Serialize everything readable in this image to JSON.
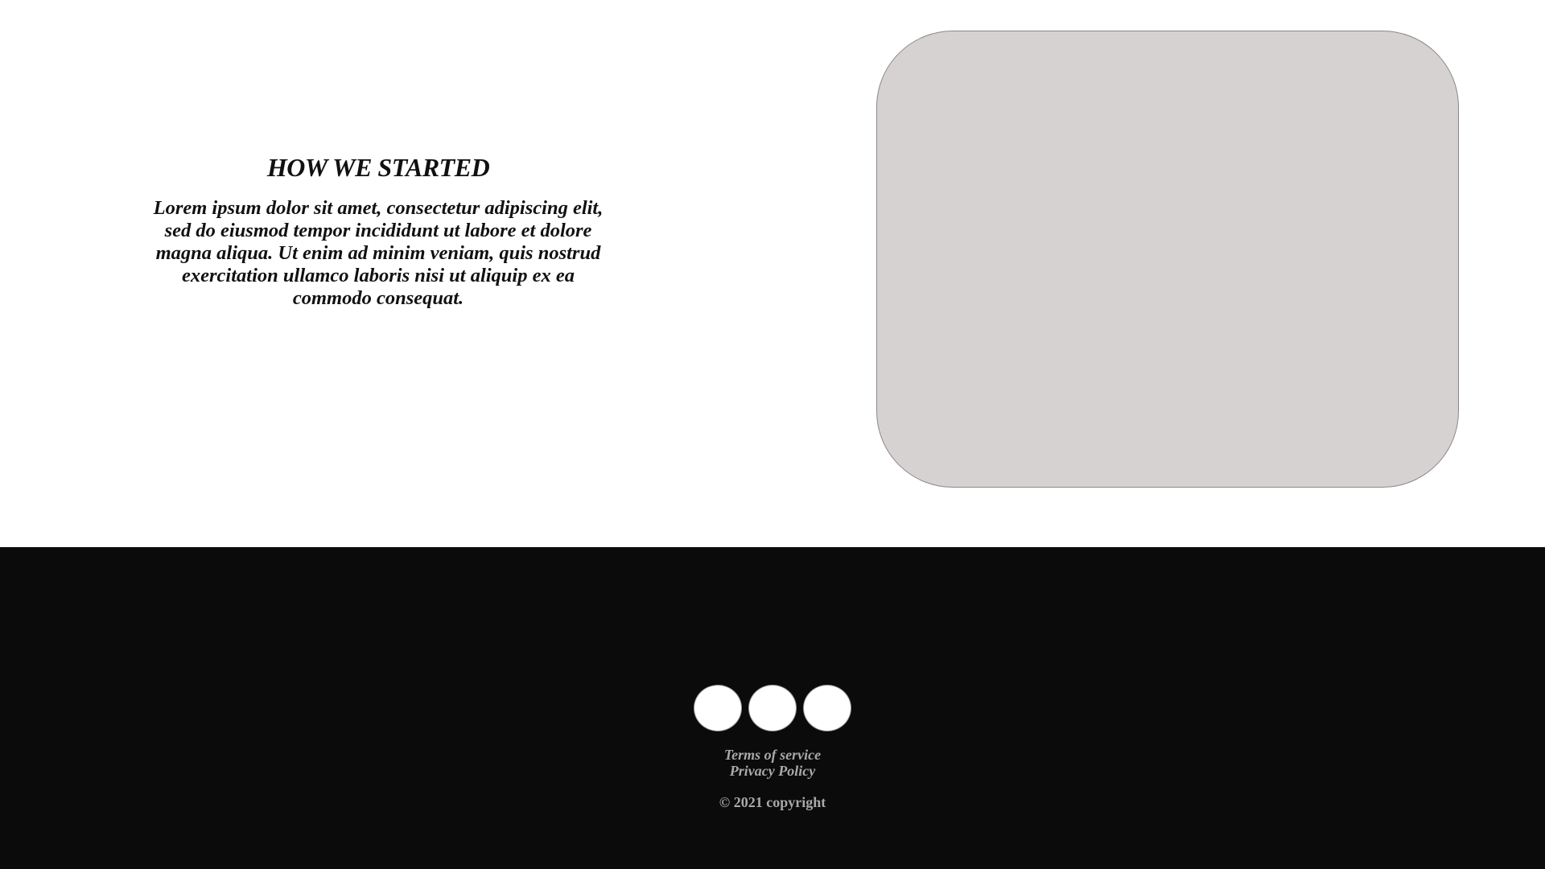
{
  "story": {
    "title": "HOW WE STARTED",
    "body": "Lorem ipsum dolor sit amet, consectetur adipiscing elit, sed do eiusmod tempor incididunt ut labore et dolore magna aliqua. Ut enim ad minim veniam, quis nostrud exercitation ullamco laboris nisi ut aliquip ex ea commodo consequat."
  },
  "colors": {
    "footer_background": "#0b0b0b",
    "image_placeholder": "#d6d2d1",
    "footer_text": "#a9a9a9"
  },
  "footer": {
    "social_icons": [
      "social-icon-1",
      "social-icon-2",
      "social-icon-3"
    ],
    "links": {
      "terms": "Terms of service",
      "privacy": "Privacy Policy"
    },
    "copyright": "© 2021 copyright"
  }
}
